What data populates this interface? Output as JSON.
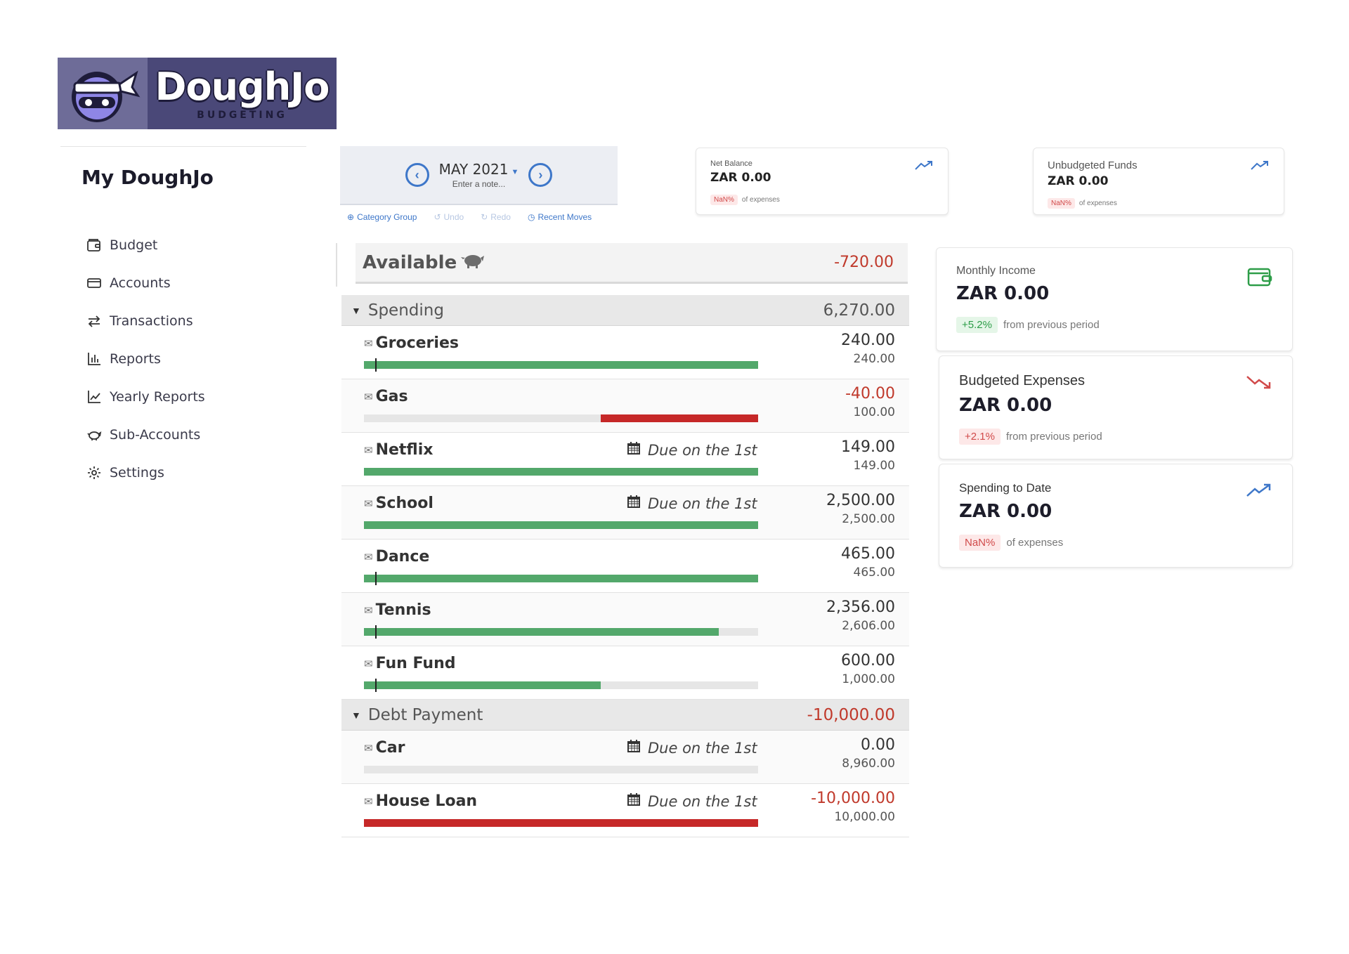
{
  "logo": {
    "title": "DoughJo",
    "subtitle": "BUDGETING"
  },
  "sidebar": {
    "title": "My DoughJo",
    "items": [
      {
        "label": "Budget",
        "icon": "wallet-icon"
      },
      {
        "label": "Accounts",
        "icon": "credit-card-icon"
      },
      {
        "label": "Transactions",
        "icon": "arrows-exchange-icon"
      },
      {
        "label": "Reports",
        "icon": "bar-chart-icon"
      },
      {
        "label": "Yearly Reports",
        "icon": "line-chart-icon"
      },
      {
        "label": "Sub-Accounts",
        "icon": "piggy-bank-icon"
      },
      {
        "label": "Settings",
        "icon": "gear-icon"
      }
    ]
  },
  "month": {
    "label": "MAY 2021",
    "note_placeholder": "Enter a note..."
  },
  "toolbar": {
    "category_group": "Category Group",
    "undo": "Undo",
    "redo": "Redo",
    "recent_moves": "Recent Moves"
  },
  "stats": {
    "net_balance": {
      "label": "Net Balance",
      "value": "ZAR 0.00",
      "badge": "NaN%",
      "foot": "of expenses",
      "trend": "up",
      "color": "#3e77c9"
    },
    "unbudgeted": {
      "label": "Unbudgeted Funds",
      "value": "ZAR 0.00",
      "badge": "NaN%",
      "foot": "of expenses",
      "trend": "up",
      "color": "#3e77c9"
    },
    "monthly_income": {
      "label": "Monthly Income",
      "value": "ZAR 0.00",
      "badge": "+5.2%",
      "foot": "from previous period",
      "color": "#2d9d48"
    },
    "budgeted_expenses": {
      "label": "Budgeted Expenses",
      "value": "ZAR 0.00",
      "badge": "+2.1%",
      "foot": "from previous period",
      "trend": "down",
      "color": "#d14a4a"
    },
    "spending_to_date": {
      "label": "Spending to Date",
      "value": "ZAR 0.00",
      "badge": "NaN%",
      "foot": "of expenses",
      "trend": "up",
      "color": "#3e77c9"
    }
  },
  "available": {
    "label": "Available",
    "value": "-720.00"
  },
  "groups": [
    {
      "label": "Spending",
      "total": "6,270.00",
      "categories": [
        {
          "name": "Groceries",
          "due": "",
          "available": "240.00",
          "budgeted": "240.00",
          "progress": 1.0,
          "bar_color": "green",
          "marker": true
        },
        {
          "name": "Gas",
          "due": "",
          "available": "-40.00",
          "budgeted": "100.00",
          "progress": 0.4,
          "bar_color": "red",
          "marker": false
        },
        {
          "name": "Netflix",
          "due": "Due on the 1st",
          "available": "149.00",
          "budgeted": "149.00",
          "progress": 1.0,
          "bar_color": "green",
          "marker": false
        },
        {
          "name": "School",
          "due": "Due on the 1st",
          "available": "2,500.00",
          "budgeted": "2,500.00",
          "progress": 1.0,
          "bar_color": "green",
          "marker": false
        },
        {
          "name": "Dance",
          "due": "",
          "available": "465.00",
          "budgeted": "465.00",
          "progress": 1.0,
          "bar_color": "green",
          "marker": true
        },
        {
          "name": "Tennis",
          "due": "",
          "available": "2,356.00",
          "budgeted": "2,606.00",
          "progress": 0.9,
          "bar_color": "green",
          "marker": true
        },
        {
          "name": "Fun Fund",
          "due": "",
          "available": "600.00",
          "budgeted": "1,000.00",
          "progress": 0.6,
          "bar_color": "green",
          "marker": true
        }
      ]
    },
    {
      "label": "Debt Payment",
      "total": "-10,000.00",
      "categories": [
        {
          "name": "Car",
          "due": "Due on the 1st",
          "available": "0.00",
          "budgeted": "8,960.00",
          "progress": 0.0,
          "bar_color": "green",
          "marker": false
        },
        {
          "name": "House Loan",
          "due": "Due on the 1st",
          "available": "-10,000.00",
          "budgeted": "10,000.00",
          "progress": 1.0,
          "bar_color": "red",
          "marker": false
        }
      ]
    }
  ]
}
